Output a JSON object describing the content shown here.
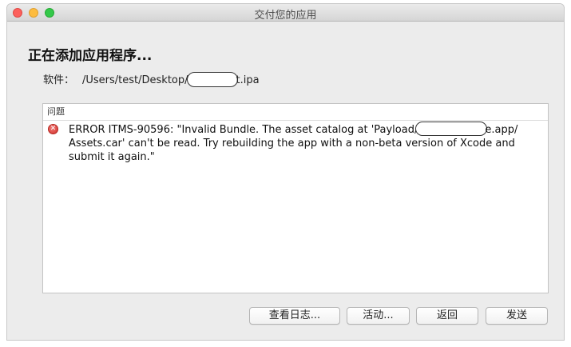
{
  "window": {
    "title": "交付您的应用"
  },
  "main": {
    "heading": "正在添加应用程序...",
    "software_label": "软件：",
    "software_path_start": "/Users/test/Desktop/",
    "software_path_end": "t.ipa"
  },
  "issues": {
    "header": "问题",
    "items": [
      {
        "severity_icon": "error-icon",
        "text_start": "ERROR ITMS-90596: \"Invalid Bundle. The asset catalog at 'Payload/",
        "text_end": "e.app/ Assets.car' can't be read. Try rebuilding the app with a non-beta version of Xcode and submit it again.\""
      }
    ]
  },
  "buttons": {
    "view_log": "查看日志...",
    "activity": "活动...",
    "back": "返回",
    "send": "发送"
  },
  "colors": {
    "close": "#fc605c",
    "minimize": "#fdbc40",
    "maximize": "#34c84a",
    "error": "#d2302b"
  }
}
